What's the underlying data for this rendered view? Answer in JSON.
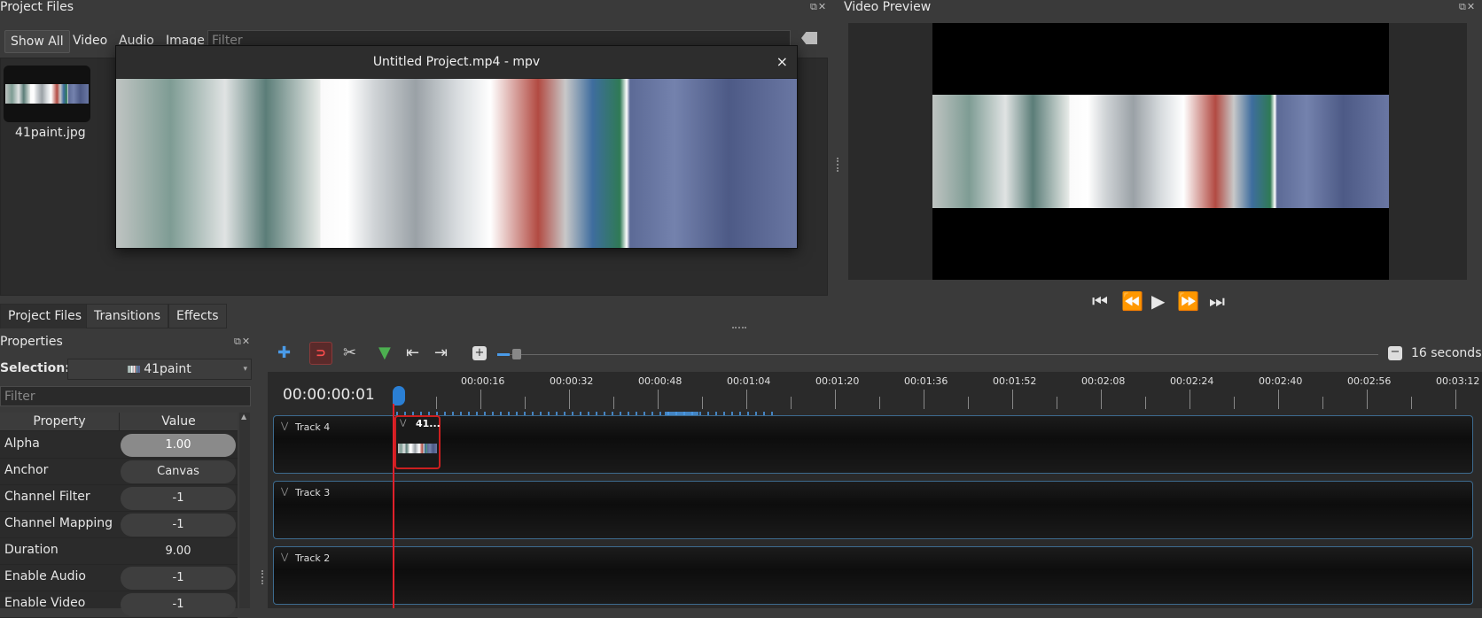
{
  "project_files": {
    "title": "Project Files",
    "tabs": [
      "Show All",
      "Video",
      "Audio",
      "Image"
    ],
    "filter_placeholder": "Filter",
    "file_name": "41paint.jpg"
  },
  "mpv": {
    "title": "Untitled Project.mp4 - mpv",
    "close": "×"
  },
  "video_preview": {
    "title": "Video Preview"
  },
  "bottom_tabs": [
    "Project Files",
    "Transitions",
    "Effects"
  ],
  "properties": {
    "title": "Properties",
    "selection_label": "Selection:",
    "selection_value": "41paint",
    "filter_placeholder": "Filter",
    "col_property": "Property",
    "col_value": "Value",
    "rows": [
      {
        "name": "Alpha",
        "value": "1.00"
      },
      {
        "name": "Anchor",
        "value": "Canvas"
      },
      {
        "name": "Channel Filter",
        "value": "-1"
      },
      {
        "name": "Channel Mapping",
        "value": "-1"
      },
      {
        "name": "Duration",
        "value": "9.00"
      },
      {
        "name": "Enable Audio",
        "value": "-1"
      },
      {
        "name": "Enable Video",
        "value": "-1"
      }
    ]
  },
  "timeline": {
    "zoom_label": "16 seconds",
    "timecode": "00:00:00:01",
    "ruler": [
      "00:00:16",
      "00:00:32",
      "00:00:48",
      "00:01:04",
      "00:01:20",
      "00:01:36",
      "00:01:52",
      "00:02:08",
      "00:02:24",
      "00:02:40",
      "00:02:56",
      "00:03:12"
    ],
    "tracks": [
      "Track 4",
      "Track 3",
      "Track 2"
    ],
    "clip_label": "41..."
  },
  "colors": {
    "accent": "#3d6b8f",
    "playhead": "#e0202a",
    "clip_border": "#cc1f1f"
  }
}
